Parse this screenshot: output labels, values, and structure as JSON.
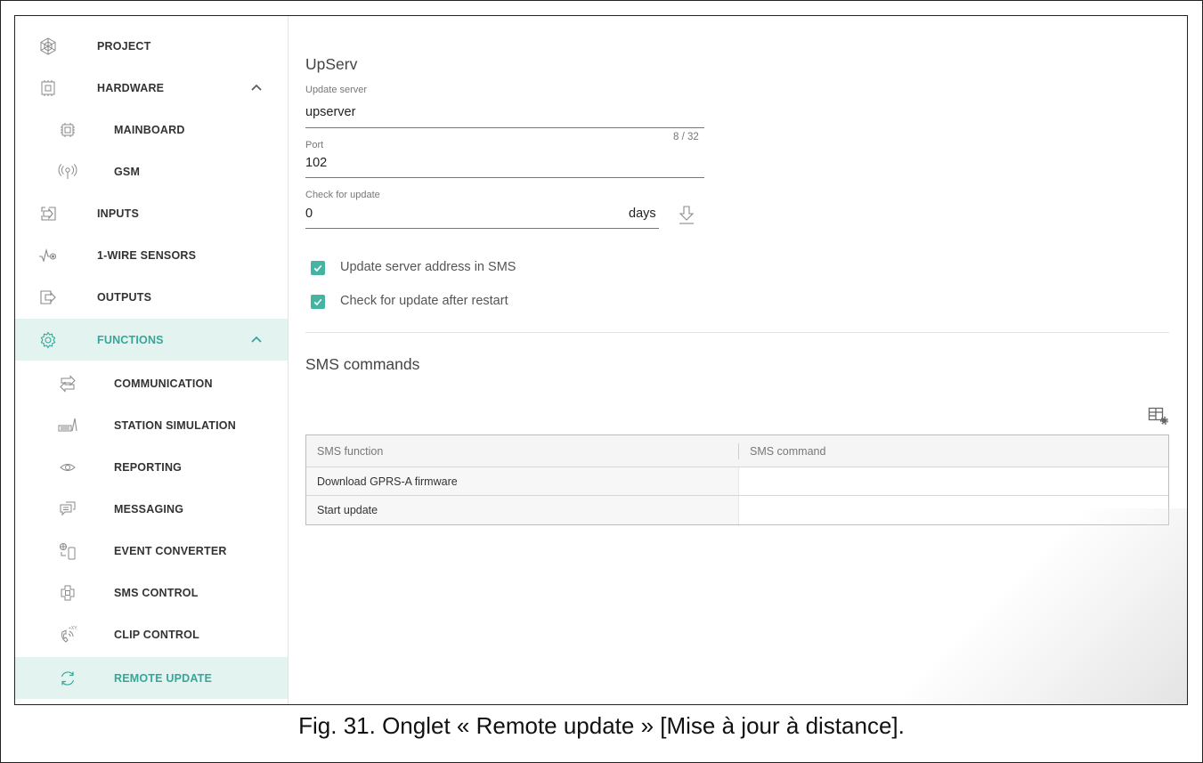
{
  "sidebar": {
    "items": [
      {
        "label": "PROJECT",
        "icon": "project-icon"
      },
      {
        "label": "HARDWARE",
        "icon": "hardware-icon",
        "expanded": true
      },
      {
        "label": "MAINBOARD",
        "icon": "mainboard-icon"
      },
      {
        "label": "GSM",
        "icon": "antenna-icon"
      },
      {
        "label": "INPUTS",
        "icon": "inputs-icon"
      },
      {
        "label": "1-WIRE SENSORS",
        "icon": "sensor-icon"
      },
      {
        "label": "OUTPUTS",
        "icon": "outputs-icon"
      },
      {
        "label": "FUNCTIONS",
        "icon": "gear-icon",
        "expanded": true
      },
      {
        "label": "COMMUNICATION",
        "icon": "communication-icon"
      },
      {
        "label": "STATION SIMULATION",
        "icon": "station-icon"
      },
      {
        "label": "REPORTING",
        "icon": "eye-icon"
      },
      {
        "label": "MESSAGING",
        "icon": "message-icon"
      },
      {
        "label": "EVENT CONVERTER",
        "icon": "event-converter-icon"
      },
      {
        "label": "SMS CONTROL",
        "icon": "sms-control-icon"
      },
      {
        "label": "CLIP CONTROL",
        "icon": "clip-icon"
      },
      {
        "label": "REMOTE UPDATE",
        "icon": "refresh-icon",
        "selected": true
      }
    ]
  },
  "upserv": {
    "title": "UpServ",
    "update_server": {
      "label": "Update server",
      "value": "upserver",
      "counter": "8 / 32"
    },
    "port": {
      "label": "Port",
      "value": "102"
    },
    "check_for_update": {
      "label": "Check for update",
      "value": "0",
      "unit": "days"
    },
    "checkboxes": [
      {
        "label": "Update server address in SMS",
        "checked": true
      },
      {
        "label": "Check for update after restart",
        "checked": true
      }
    ]
  },
  "sms": {
    "title": "SMS commands",
    "columns": [
      "SMS function",
      "SMS command"
    ],
    "rows": [
      {
        "function": "Download GPRS-A firmware",
        "command": ""
      },
      {
        "function": "Start update",
        "command": ""
      }
    ]
  },
  "caption": "Fig. 31. Onglet « Remote update » [Mise à jour à distance].",
  "colors": {
    "accent": "#45b4a3",
    "active_bg": "#e3f3f0",
    "teal_text": "#35a79a"
  }
}
